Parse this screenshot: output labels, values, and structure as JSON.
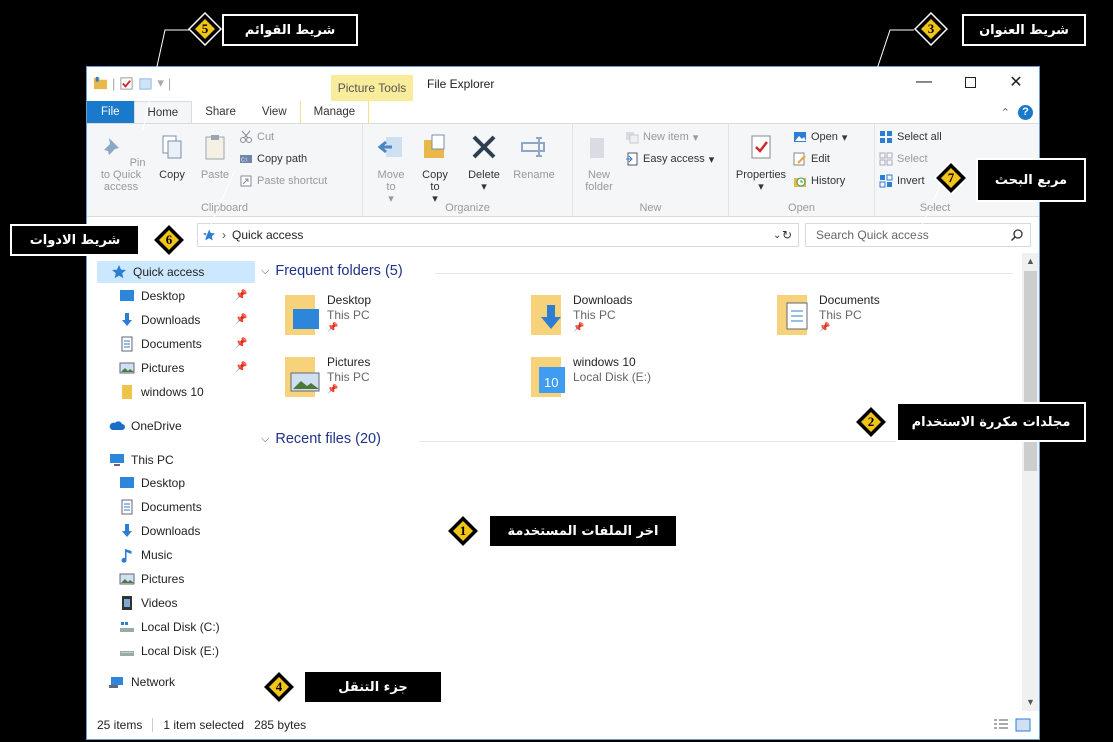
{
  "window": {
    "title": "File Explorer",
    "context_tab_group": "Picture Tools",
    "tabs": [
      "File",
      "Home",
      "Share",
      "View",
      "Manage"
    ]
  },
  "ribbon": {
    "clipboard": {
      "label": "Clipboard",
      "pin_label": "Pin to Quick access",
      "copy_label": "Copy",
      "paste_label": "Paste",
      "cut_label": "Cut",
      "copy_path_label": "Copy path",
      "paste_shortcut_label": "Paste shortcut"
    },
    "organize": {
      "label": "Organize",
      "move_to_label": "Move to",
      "copy_to_label": "Copy to",
      "delete_label": "Delete",
      "rename_label": "Rename"
    },
    "new": {
      "label": "New",
      "new_folder_label": "New folder",
      "new_item_label": "New item",
      "easy_access_label": "Easy access"
    },
    "open": {
      "label": "Open",
      "properties_label": "Properties",
      "open_label": "Open",
      "edit_label": "Edit",
      "history_label": "History"
    },
    "select": {
      "label": "Select",
      "select_all_label": "Select all",
      "select_none_label": "Select",
      "invert_label": "Invert"
    }
  },
  "address": {
    "path": "Quick access",
    "search_placeholder": "Search Quick access"
  },
  "nav": {
    "quick_access": "Quick access",
    "qa_items": [
      "Desktop",
      "Downloads",
      "Documents",
      "Pictures",
      "windows 10"
    ],
    "onedrive": "OneDrive",
    "this_pc": "This PC",
    "pc_items": [
      "Desktop",
      "Documents",
      "Downloads",
      "Music",
      "Pictures",
      "Videos",
      "Local Disk (C:)",
      "Local Disk (E:)"
    ],
    "network": "Network"
  },
  "content": {
    "frequent_heading": "Frequent folders (5)",
    "recent_heading": "Recent files (20)",
    "folders": [
      {
        "name": "Desktop",
        "location": "This PC"
      },
      {
        "name": "Downloads",
        "location": "This PC"
      },
      {
        "name": "Documents",
        "location": "This PC"
      },
      {
        "name": "Pictures",
        "location": "This PC"
      },
      {
        "name": "windows 10",
        "location": "Local Disk (E:)"
      }
    ]
  },
  "status": {
    "items": "25 items",
    "selected": "1 item selected",
    "size": "285 bytes"
  },
  "annotations": [
    {
      "num": "1",
      "text": "اخر الملفات المستخدمة"
    },
    {
      "num": "2",
      "text": "مجلدات مكررة الاستخدام"
    },
    {
      "num": "3",
      "text": "شريط العنوان"
    },
    {
      "num": "4",
      "text": "جزء التنقل"
    },
    {
      "num": "5",
      "text": "شريط القوائم"
    },
    {
      "num": "6",
      "text": "شريط الادوات"
    },
    {
      "num": "7",
      "text": "مربع البحث"
    }
  ],
  "colors": {
    "file_tab": "#1979ca",
    "heading_blue": "#1e3287",
    "badge_gold": "#f2c419",
    "picture_tools": "#f9ec9b"
  }
}
